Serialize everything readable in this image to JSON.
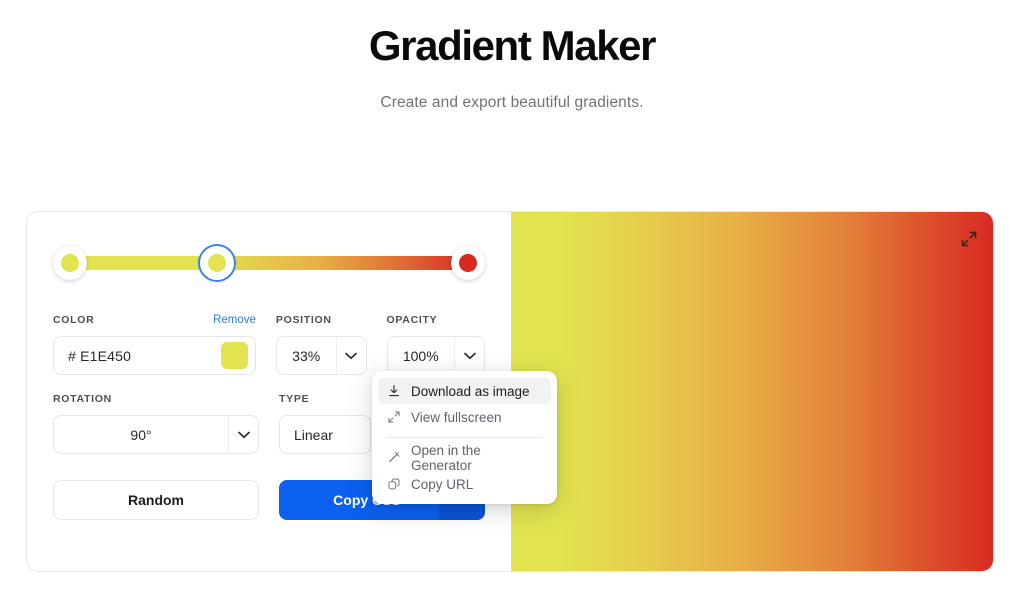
{
  "header": {
    "title": "Gradient Maker",
    "subtitle": "Create and export beautiful gradients."
  },
  "gradient": {
    "stops": [
      {
        "color": "#E1E450",
        "position": "0%",
        "selected": false
      },
      {
        "color": "#E1E450",
        "position": "33%",
        "selected": true
      },
      {
        "color": "#D92A22",
        "position": "100%",
        "selected": false
      }
    ],
    "preview_css": "linear-gradient(90deg, #E1E450 0%, #E1E450 33%, #D92A22 100%)",
    "expand_icon": "expand-icon"
  },
  "fields": {
    "color": {
      "label": "COLOR",
      "remove_label": "Remove",
      "value": "# E1E450",
      "swatch_color": "#E1E450"
    },
    "position": {
      "label": "POSITION",
      "value": "33%",
      "caret_icon": "chevron-down-icon"
    },
    "opacity": {
      "label": "OPACITY",
      "value": "100%",
      "caret_icon": "chevron-down-icon"
    },
    "rotation": {
      "label": "ROTATION",
      "value": "90°",
      "caret_icon": "chevron-down-icon"
    },
    "type": {
      "label": "TYPE",
      "value": "Linear",
      "caret_icon": "chevron-down-icon"
    }
  },
  "buttons": {
    "random": "Random",
    "copy_css": "Copy CSS",
    "copy_css_caret_icon": "chevron-down-icon"
  },
  "menu": {
    "items": [
      {
        "label": "Download as image",
        "icon": "download-icon",
        "active": true
      },
      {
        "label": "View fullscreen",
        "icon": "expand-icon",
        "active": false
      },
      {
        "label": "Open in the Generator",
        "icon": "magic-wand-icon",
        "active": false
      },
      {
        "label": "Copy URL",
        "icon": "copy-icon",
        "active": false
      }
    ]
  },
  "colors": {
    "accent_blue": "#0B60F0",
    "link_blue": "#2F7DE1",
    "yellow": "#E1E450",
    "red": "#D92A22"
  }
}
